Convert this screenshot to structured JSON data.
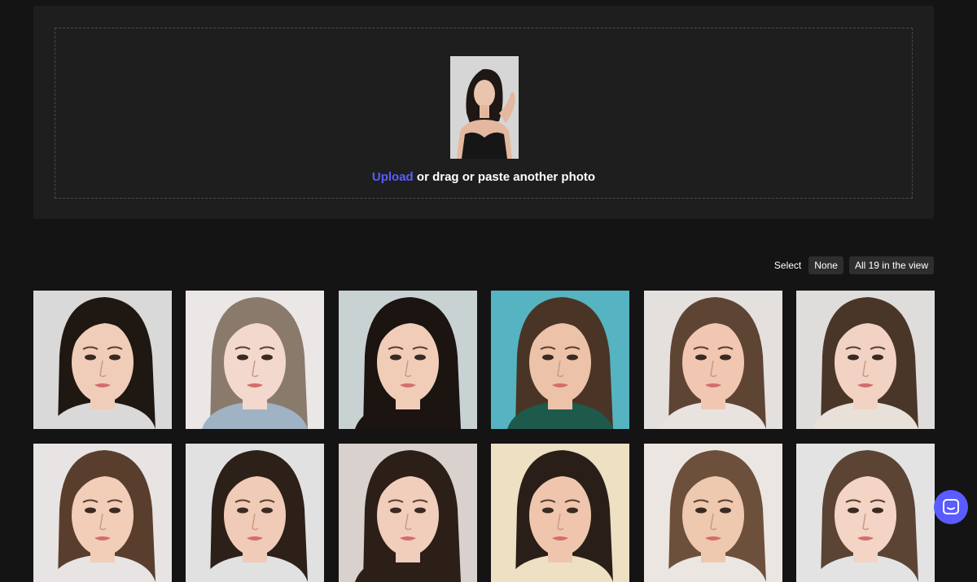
{
  "upload": {
    "link_label": "Upload",
    "instruction": " or drag or paste another photo"
  },
  "select": {
    "label": "Select",
    "none_label": "None",
    "all_label": "All 19 in the view"
  },
  "faces": [
    {
      "bg": "#d9d9d9",
      "hair": "#1f1712",
      "skin": "#f0cdb8",
      "shirt": "#d9d9d9"
    },
    {
      "bg": "#ebe7e6",
      "hair": "#8a7a6c",
      "skin": "#f3d8cd",
      "shirt": "#9fb3c4"
    },
    {
      "bg": "#c9d2d3",
      "hair": "#1b1411",
      "skin": "#f1cdb8",
      "shirt": "#1b1411"
    },
    {
      "bg": "#56b3c1",
      "hair": "#4a3426",
      "skin": "#ecc3a8",
      "shirt": "#1e5a4c"
    },
    {
      "bg": "#e4e0de",
      "hair": "#5e4433",
      "skin": "#f1c7b1",
      "shirt": "#e9e3e0"
    },
    {
      "bg": "#dfdcdc",
      "hair": "#4a3628",
      "skin": "#f2d3c3",
      "shirt": "#e8e1d9"
    },
    {
      "bg": "#e7e4e3",
      "hair": "#5a3e2d",
      "skin": "#f2cdb8",
      "shirt": "#e7e4e3"
    },
    {
      "bg": "#e1e1e1",
      "hair": "#2c2019",
      "skin": "#f0cbb7",
      "shirt": "#e1e1e1"
    },
    {
      "bg": "#d8d1cd",
      "hair": "#2b1f18",
      "skin": "#f1cdbb",
      "shirt": "#2b1f18"
    },
    {
      "bg": "#ede0c3",
      "hair": "#2a1f18",
      "skin": "#efc6ad",
      "shirt": "#ede0c3"
    },
    {
      "bg": "#ece6e2",
      "hair": "#6d503b",
      "skin": "#efc8b0",
      "shirt": "#ece6e2"
    },
    {
      "bg": "#e3e3e3",
      "hair": "#5b4434",
      "skin": "#f3d4c5",
      "shirt": "#e3e3e3"
    }
  ]
}
